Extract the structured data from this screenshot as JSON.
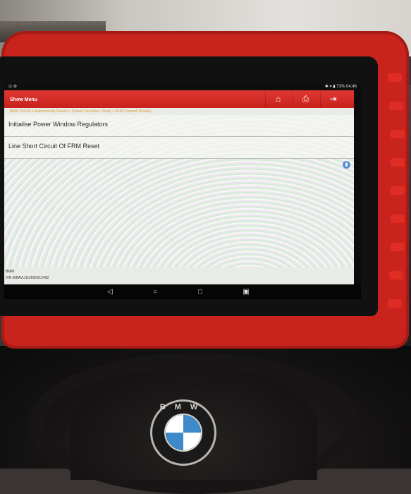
{
  "status_bar": {
    "battery": "73%",
    "time": "04:46"
  },
  "app_bar": {
    "title": "Show Menu",
    "home_icon": "home-icon",
    "print_icon": "printer-icon",
    "exit_icon": "exit-icon"
  },
  "breadcrumb": "BMW V50.40 > Automatically Search > System Selection > Body > FRM (Footwell Module)",
  "menu_items": [
    {
      "label": "Initialise Power Window Regulators"
    },
    {
      "label": "Line Short Circuit Of FRM Reset"
    }
  ],
  "footer": {
    "make": "BMW",
    "vin": "VIN WBAVU11050K012492"
  },
  "nav_bar": {
    "back_icon": "back-triangle-icon",
    "home_icon": "home-circle-icon",
    "recents_icon": "recents-square-icon",
    "screenshot_icon": "screenshot-icon"
  },
  "logo": {
    "letters": "BMW"
  },
  "colors": {
    "tablet_body": "#c9231e",
    "app_bar": "#d42b24",
    "breadcrumb_text": "#d99a3a"
  }
}
